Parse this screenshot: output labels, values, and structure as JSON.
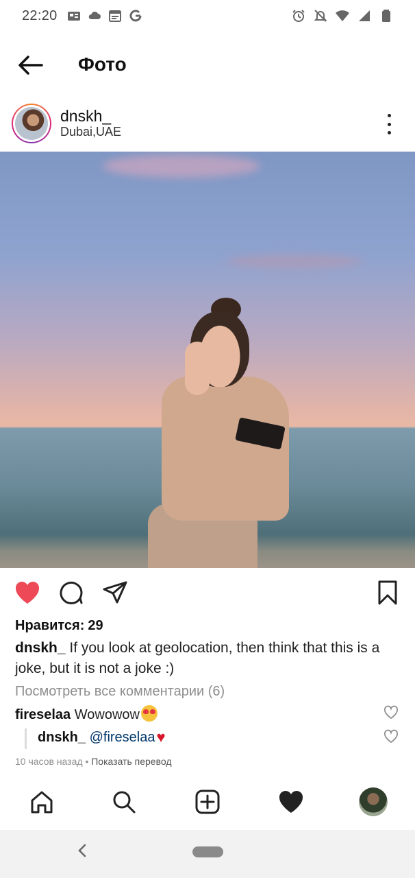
{
  "status_bar": {
    "time": "22:20"
  },
  "header": {
    "title": "Фото"
  },
  "post": {
    "username": "dnskh_",
    "location": "Dubai,UAE",
    "likes_label": "Нравится:",
    "likes_count": "29",
    "caption_user": "dnskh_",
    "caption_text": "If you look at geolocation, then think that this is a joke, but it is not a joke :)",
    "view_comments": "Посмотреть все комментарии (6)",
    "comments": [
      {
        "user": "fireselaa",
        "text": "Wowowow"
      },
      {
        "user": "dnskh_",
        "mention": "@fireselaa"
      }
    ],
    "time_ago": "10 часов назад",
    "separator": "•",
    "translate": "Показать перевод"
  },
  "colors": {
    "like_red": "#ed4956",
    "mention_blue": "#00376b"
  }
}
